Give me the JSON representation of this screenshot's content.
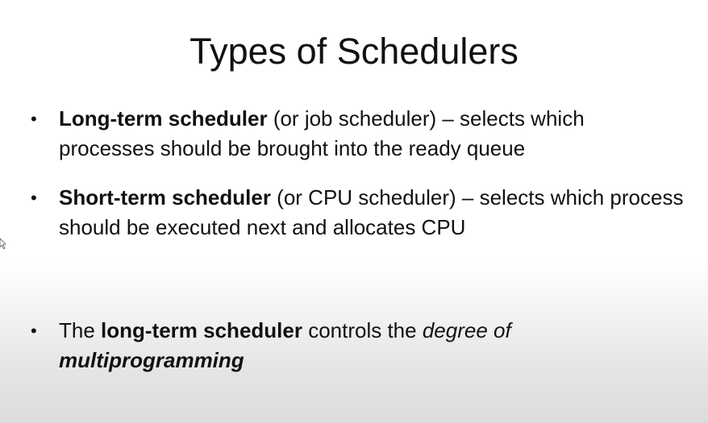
{
  "slide": {
    "title": "Types of Schedulers",
    "bullets": [
      {
        "marker": "•",
        "bold": "Long-term scheduler",
        "rest": " (or job scheduler) – selects which processes should be brought into the ready queue"
      },
      {
        "marker": "•",
        "bold": "Short-term scheduler",
        "rest": " (or CPU scheduler) – selects which process should be executed next and allocates CPU"
      },
      {
        "marker": "•",
        "prefix": "The ",
        "bold": "long-term scheduler",
        "middle": " controls the ",
        "italic": "degree of",
        "bold_italic": "multiprogramming"
      }
    ]
  }
}
